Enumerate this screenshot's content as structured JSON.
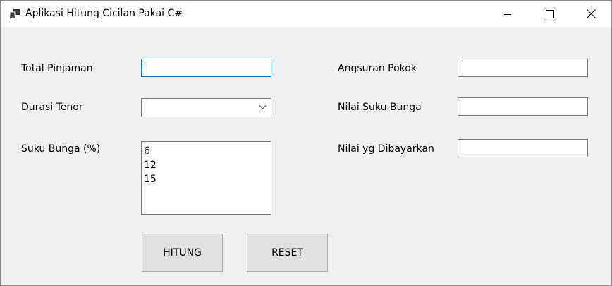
{
  "window": {
    "title": "Aplikasi Hitung Cicilan Pakai C#",
    "icon": "app-window-icon"
  },
  "form": {
    "total_pinjaman_label": "Total Pinjaman",
    "total_pinjaman_value": "",
    "durasi_tenor_label": "Durasi Tenor",
    "durasi_tenor_selected": "",
    "suku_bunga_label": "Suku Bunga (%)",
    "suku_bunga_options": [
      "6",
      "12",
      "15"
    ],
    "angsuran_pokok_label": "Angsuran Pokok",
    "angsuran_pokok_value": "",
    "nilai_suku_bunga_label": "Nilai Suku Bunga",
    "nilai_suku_bunga_value": "",
    "nilai_dibayarkan_label": "Nilai yg Dibayarkan",
    "nilai_dibayarkan_value": ""
  },
  "buttons": {
    "hitung": "HITUNG",
    "reset": "RESET"
  }
}
